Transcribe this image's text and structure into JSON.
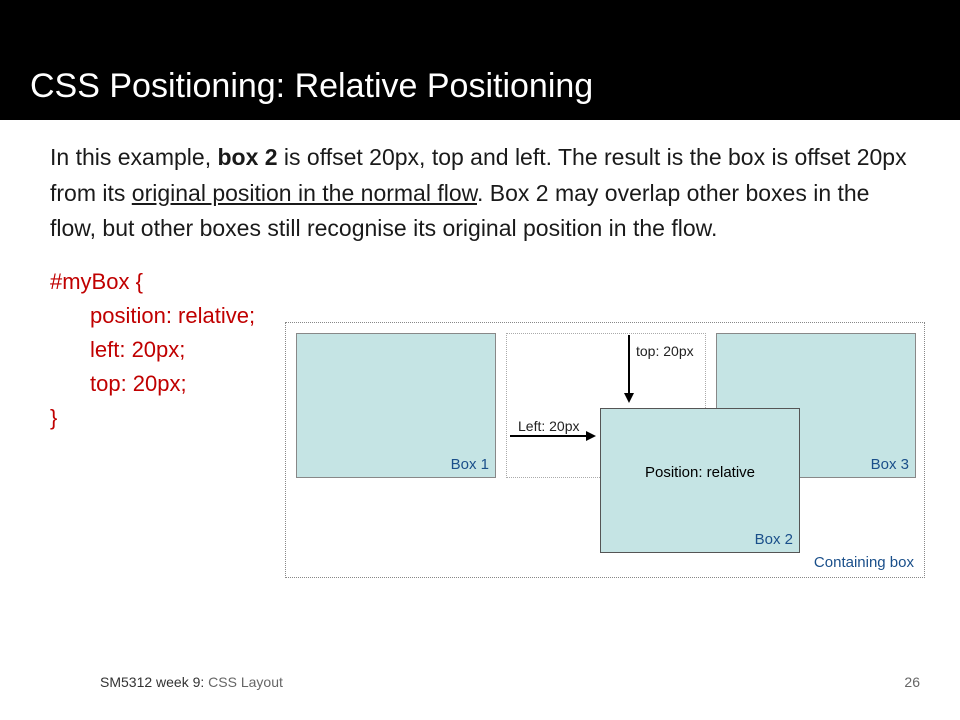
{
  "title": "CSS Positioning: Relative Positioning",
  "para": {
    "p1a": "In this example, ",
    "p1b": "box 2",
    "p1c": " is offset 20px, top and left. The result is the box is offset 20px from its ",
    "p1d": "original position in the normal flow",
    "p1e": ". Box 2 may overlap other boxes in the flow, but other boxes still recognise its original position in the flow."
  },
  "code": {
    "selector": "#myBox {",
    "l1": "position: relative;",
    "l2": "left: 20px;",
    "l3": "top: 20px;",
    "close": "}"
  },
  "diagram": {
    "box1": "Box 1",
    "box2": "Box 2",
    "box3": "Box 3",
    "posrel": "Position: relative",
    "topLabel": "top: 20px",
    "leftLabel": "Left: 20px",
    "containing": "Containing box"
  },
  "footer": {
    "courseDark": "SM5312 week 9:",
    "courseLight": " CSS Layout",
    "page": "26"
  }
}
